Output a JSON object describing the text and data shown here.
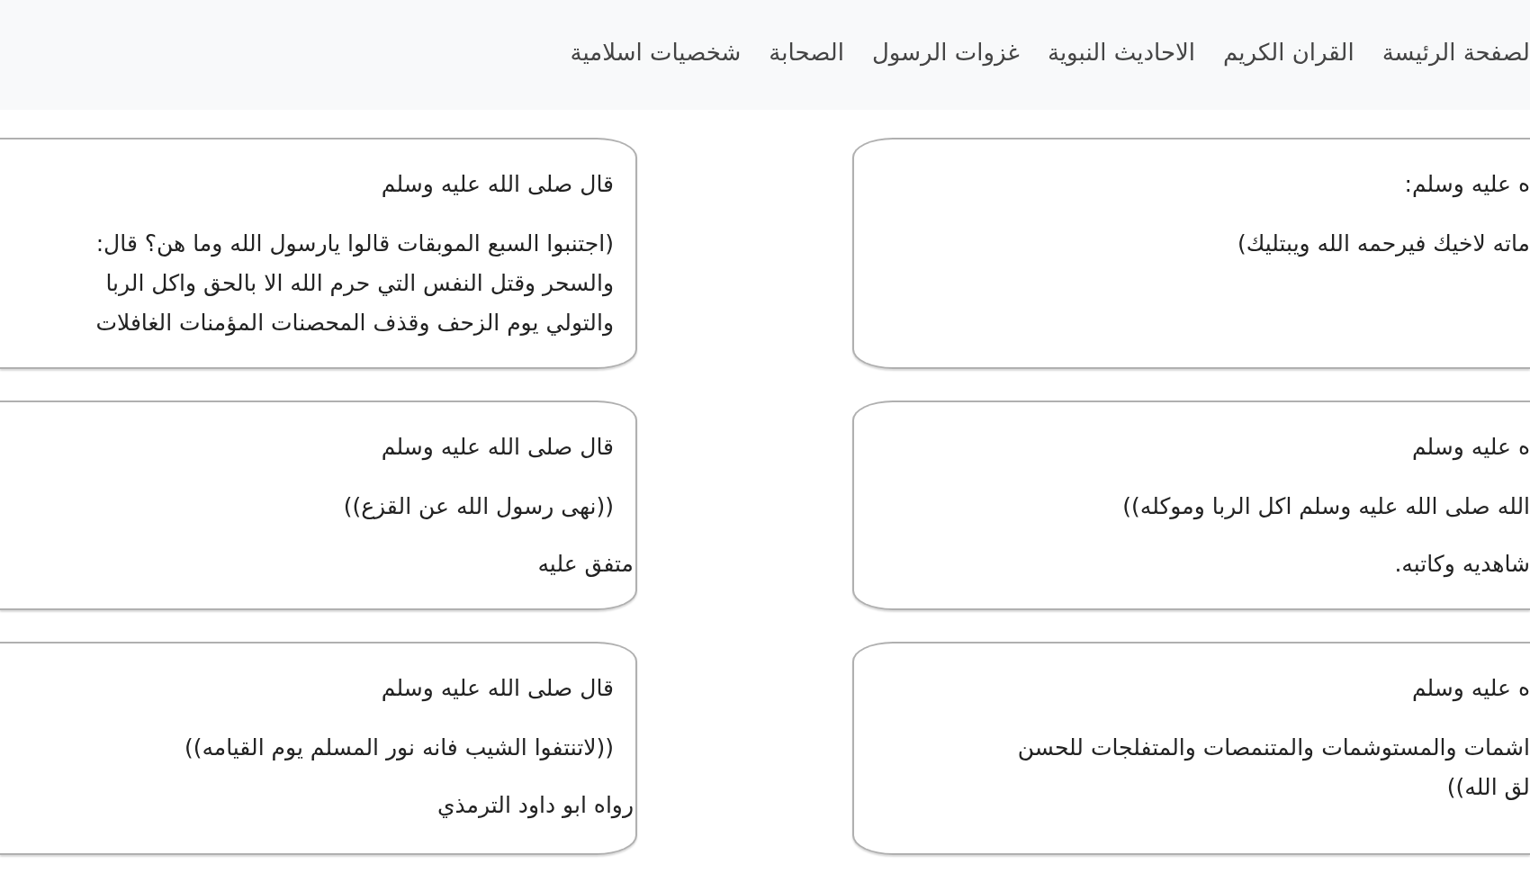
{
  "nav": {
    "links": [
      "لصفحة الرئيسة",
      "القران الكريم",
      "الاحاديث النبوية",
      "غزوات الرسول",
      "الصحابة",
      "شخصيات اسلامية"
    ]
  },
  "rows": [
    {
      "cards": [
        {
          "title": "ه عليه وسلم:",
          "lines": [
            "ماته لاخيك فيرحمه الله ويبتليك)"
          ]
        },
        {
          "title": "قال صلى الله عليه وسلم",
          "lines": [
            "(اجتنبوا السبع الموبقات قالوا يارسول الله وما هن؟ قال:",
            "والسحر وقتل النفس التي حرم الله الا بالحق واكل الربا",
            "والتولي يوم الزحف وقذف المحصنات المؤمنات الغافلات"
          ]
        }
      ]
    },
    {
      "cards": [
        {
          "title": "ه عليه وسلم",
          "lines": [
            "الله صلى الله عليه وسلم اكل الربا وموكله))"
          ],
          "source": "شاهديه وكاتبه."
        },
        {
          "title": "قال صلى الله عليه وسلم",
          "lines": [
            "((نهى رسول الله عن القزع))"
          ],
          "source": "متفق عليه"
        }
      ]
    },
    {
      "cards": [
        {
          "title": "ه عليه وسلم",
          "lines": [
            "اشمات والمستوشمات والمتنمصات والمتفلجات للحسن",
            "لق الله))"
          ]
        },
        {
          "title": "قال صلى الله عليه وسلم",
          "lines": [
            "((لاتنتفوا الشيب فانه نور المسلم يوم القيامه))"
          ],
          "source": "رواه ابو داود الترمذي"
        }
      ]
    }
  ]
}
